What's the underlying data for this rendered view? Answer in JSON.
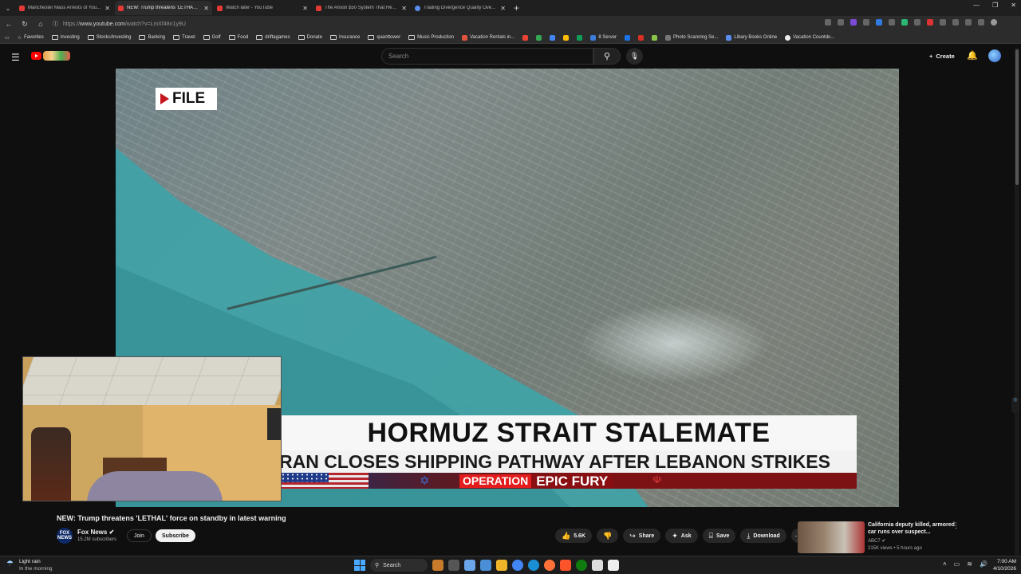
{
  "browser": {
    "tabs": [
      {
        "title": "Manchester Mass Arrests of You...",
        "active": false
      },
      {
        "title": "NEW: Trump threatens 'LETHAL' fo...",
        "active": true
      },
      {
        "title": "Watch later - YouTube",
        "active": false
      },
      {
        "title": "The Amish $50 System That Heats...",
        "active": false
      },
      {
        "title": "Trading Divergence Quality Ove...",
        "active": false
      }
    ],
    "url_scheme": "https://",
    "url_host": "www.youtube.com",
    "url_path": "/watch?v=LmXf48n1y9U",
    "bookmarks": [
      {
        "label": "Favorites",
        "icon": "star-icon"
      },
      {
        "label": "Investing",
        "icon": "folder-icon"
      },
      {
        "label": "Stocks/Investing",
        "icon": "folder-icon"
      },
      {
        "label": "Banking",
        "icon": "folder-icon"
      },
      {
        "label": "Travel",
        "icon": "folder-icon"
      },
      {
        "label": "Golf",
        "icon": "folder-icon"
      },
      {
        "label": "Food",
        "icon": "folder-icon"
      },
      {
        "label": "driftagames",
        "icon": "folder-icon"
      },
      {
        "label": "Donate",
        "icon": "folder-icon"
      },
      {
        "label": "Insurance",
        "icon": "folder-icon"
      },
      {
        "label": "quanttower",
        "icon": "folder-icon"
      },
      {
        "label": "Music Production",
        "icon": "folder-icon"
      },
      {
        "label": "Vacation Rentals in...",
        "icon": "site-icon"
      },
      {
        "label": "8 Server",
        "icon": "site-icon"
      },
      {
        "label": "Photo Scanning Se...",
        "icon": "site-icon"
      },
      {
        "label": "Libary Books Online",
        "icon": "site-icon"
      },
      {
        "label": "Vacation Countdo...",
        "icon": "site-icon"
      }
    ]
  },
  "youtube": {
    "search_placeholder": "Search",
    "create_label": "Create",
    "video": {
      "file_tag": "FILE",
      "headline": "HORMUZ STRAIT STALEMATE",
      "subheadline": "RAN CLOSES SHIPPING PATHWAY AFTER LEBANON STRIKES",
      "banner_left": "OPERATION",
      "banner_right": "EPIC FURY"
    },
    "title": "NEW: Trump threatens 'LETHAL' force on standby in latest warning",
    "channel": {
      "avatar_text": "FOX NEWS",
      "name": "Fox News",
      "subscribers": "15.2M subscribers",
      "join_label": "Join",
      "subscribe_label": "Subscribe"
    },
    "actions": {
      "likes": "5.6K",
      "share": "Share",
      "ask": "Ask",
      "save": "Save",
      "download": "Download"
    },
    "recommendation": {
      "title": "California deputy killed, armored car runs over suspect...",
      "channel": "ABC7",
      "meta": "215K views • 5 hours ago"
    }
  },
  "taskbar": {
    "weather_line1": "Light rain",
    "weather_line2": "In the morning",
    "search_label": "Search",
    "time": "7:00 AM",
    "date": "4/10/2026"
  }
}
